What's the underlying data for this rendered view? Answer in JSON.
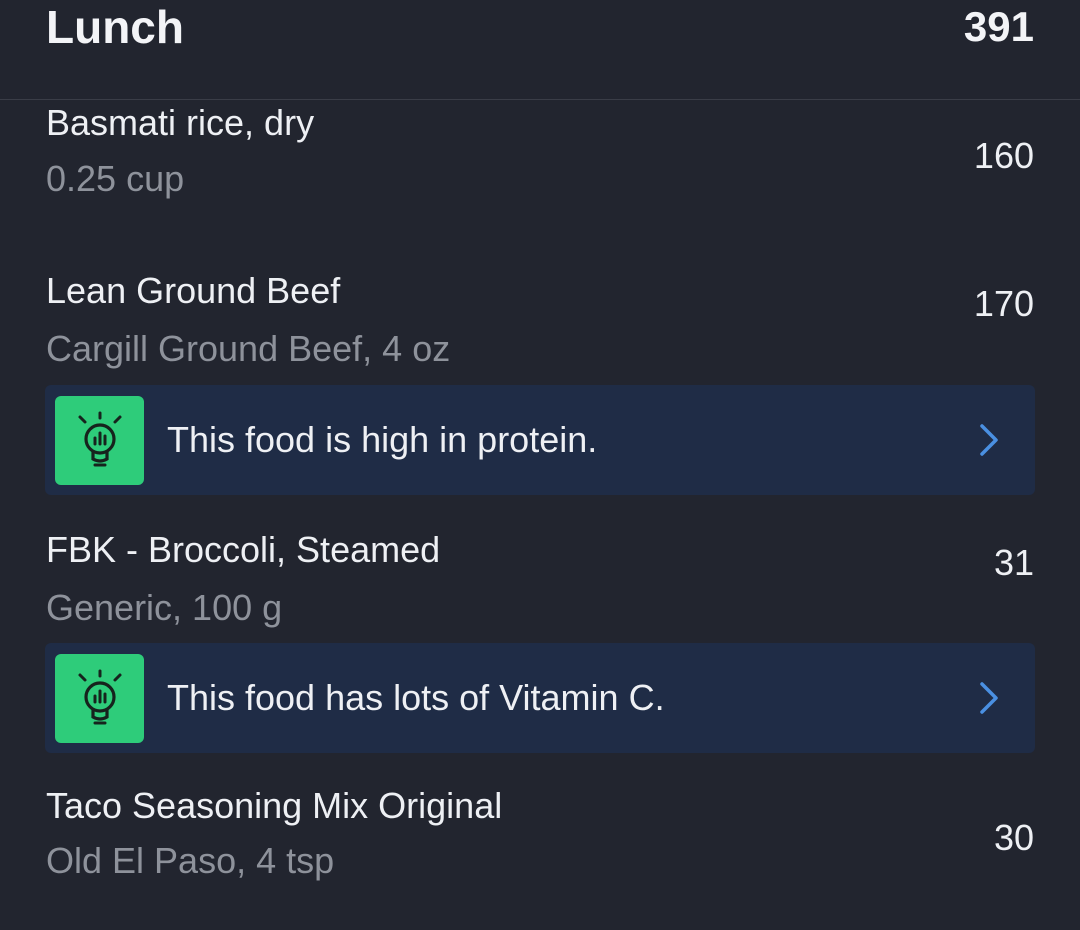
{
  "meal": {
    "title": "Lunch",
    "total_calories": "391"
  },
  "foods": [
    {
      "name": "Basmati rice, dry",
      "detail": "0.25 cup",
      "calories": "160"
    },
    {
      "name": "Lean Ground Beef",
      "detail": "Cargill Ground Beef, 4 oz",
      "calories": "170"
    },
    {
      "name": "FBK - Broccoli, Steamed",
      "detail": "Generic, 100 g",
      "calories": "31"
    },
    {
      "name": "Taco Seasoning Mix Original",
      "detail": "Old El Paso, 4 tsp",
      "calories": "30"
    }
  ],
  "insights": [
    {
      "text": "This food is high in protein.",
      "icon": "lightbulb-icon"
    },
    {
      "text": "This food has lots of Vitamin C.",
      "icon": "lightbulb-icon"
    }
  ],
  "colors": {
    "background": "#22252f",
    "insight_background": "#1f2c46",
    "insight_icon": "#2ecc7a",
    "chevron": "#4a90e2",
    "secondary_text": "#8e929b"
  }
}
